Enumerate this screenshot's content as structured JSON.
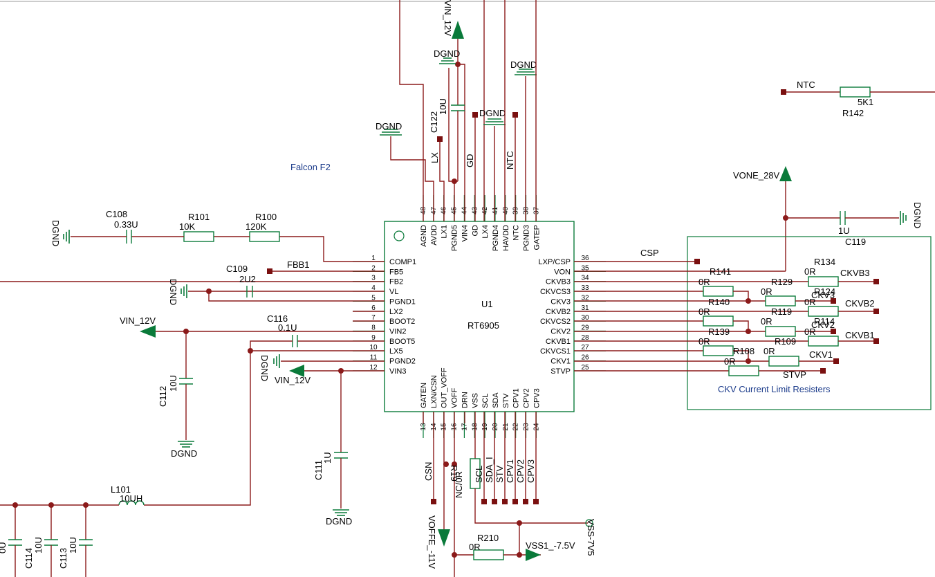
{
  "titles": {
    "board": "Falcon F2",
    "chip_ref": "U1",
    "chip_part": "RT6905",
    "box_title": "CKV  Current Limit Resisters"
  },
  "left_pins": [
    "COMP1",
    "FB5",
    "FB2",
    "VL",
    "PGND1",
    "LX2",
    "BOOT2",
    "VIN2",
    "BOOT5",
    "LX5",
    "PGND2",
    "VIN3"
  ],
  "left_nums": [
    "1",
    "2",
    "3",
    "4",
    "5",
    "6",
    "7",
    "8",
    "9",
    "10",
    "11",
    "12"
  ],
  "right_pins": [
    "LXP/CSP",
    "VON",
    "CKVB3",
    "CKVCS3",
    "CKV3",
    "CKVB2",
    "CKVCS2",
    "CKV2",
    "CKVB1",
    "CKVCS1",
    "CKV1",
    "STVP"
  ],
  "right_nums": [
    "36",
    "35",
    "34",
    "33",
    "32",
    "31",
    "30",
    "29",
    "28",
    "27",
    "26",
    "25"
  ],
  "top_pins": [
    "AGND",
    "AVDD",
    "LX1",
    "PGND5",
    "VIN4",
    "GD",
    "LX4",
    "PGND4",
    "HAVDD",
    "NTC",
    "PGND3",
    "GATEP"
  ],
  "top_nums": [
    "48",
    "47",
    "46",
    "45",
    "44",
    "43",
    "42",
    "41",
    "40",
    "39",
    "38",
    "37"
  ],
  "bottom_pins": [
    "GATEN",
    "LXN/CSN",
    "OUT_VOFF",
    "VOFF",
    "DRN",
    "VSS",
    "SCL",
    "SDA",
    "STV",
    "CPV1",
    "CPV2",
    "CPV3"
  ],
  "bottom_nums": [
    "13",
    "14",
    "15",
    "16",
    "17",
    "18",
    "19",
    "20",
    "21",
    "22",
    "23",
    "24"
  ],
  "parts": {
    "c108": "C108",
    "c108v": "0.33U",
    "r101": "R101",
    "r101v": "10K",
    "r100": "R100",
    "r100v": "120K",
    "fbb1": "FBB1",
    "c109": "C109",
    "c109v": "2U2",
    "c116": "C116",
    "c116v": "0.1U",
    "c112": "C112",
    "c112v": "10U",
    "c111": "C111",
    "c111v": "1U",
    "l101": "L101",
    "l101v": "10UH",
    "c114": "C114",
    "c113": "C113",
    "c10u": "10U",
    "c10u_cut": "10U",
    "c10u_cut2": "0U",
    "c122": "C122",
    "c122v": "10U",
    "r142": "R142",
    "r142v": "5K1",
    "c119": "C119",
    "c119v": "1U",
    "r210": "R210",
    "r210v": "0R",
    "r19": "R19",
    "nc0r": "NC/0R"
  },
  "nets": {
    "dgnd": "DGND",
    "vin12": "VIN_12V",
    "vone": "VONE_28V",
    "csp": "CSP",
    "ntc": "NTC",
    "lx": "LX",
    "gd": "GD",
    "ntc_pin": "NTC",
    "csn": "CSN",
    "voffe": "VOFFE_-11V",
    "vss1": "VSS1_-7.5V",
    "vss7v5": "VSS-7V5",
    "scl": "SCL",
    "sda": "SDA_I",
    "stv": "STV",
    "cpv1": "CPV1",
    "cpv2": "CPV2",
    "cpv3": "CPV3"
  },
  "ckv_box": {
    "r141": "R141",
    "r134": "R134",
    "r129": "R129",
    "r124": "R124",
    "r140": "R140",
    "r119": "R119",
    "r114": "R114",
    "r139": "R139",
    "r109": "R109",
    "r108": "R108",
    "zero": "0R",
    "ckvb3": "CKVB3",
    "ckv3": "CKV3",
    "ckvb2": "CKVB2",
    "ckv2": "CKV2",
    "ckvb1": "CKVB1",
    "ckv1": "CKV1",
    "stvp": "STVP"
  },
  "colors": {
    "wire": "#8b1a1a",
    "component": "#0a7a3a",
    "label_blue": "#1a3a8a"
  }
}
